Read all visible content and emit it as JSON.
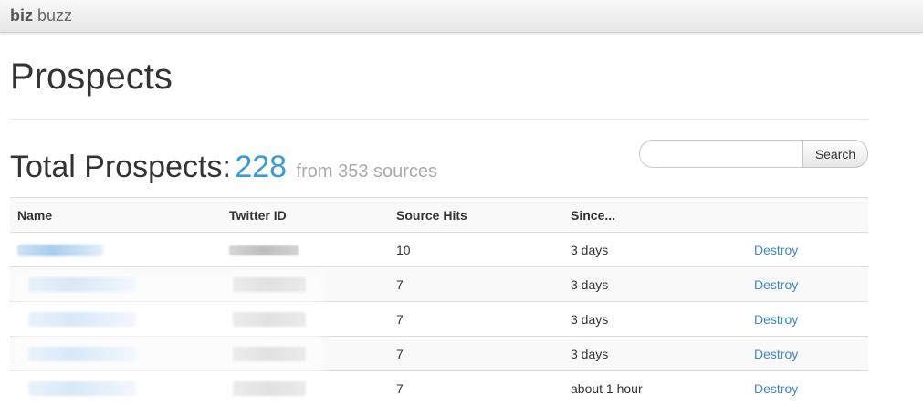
{
  "navbar": {
    "brand_bold": "biz",
    "brand_light": "buzz"
  },
  "page": {
    "title": "Prospects"
  },
  "summary": {
    "label": "Total Prospects:",
    "count": "228",
    "sources_text": "from 353 sources"
  },
  "search": {
    "value": "",
    "placeholder": "",
    "button_label": "Search"
  },
  "table": {
    "headers": {
      "name": "Name",
      "twitter_id": "Twitter ID",
      "source_hits": "Source Hits",
      "since": "Since..."
    },
    "rows": [
      {
        "source_hits": "10",
        "since": "3 days",
        "action": "Destroy"
      },
      {
        "source_hits": "7",
        "since": "3 days",
        "action": "Destroy"
      },
      {
        "source_hits": "7",
        "since": "3 days",
        "action": "Destroy"
      },
      {
        "source_hits": "7",
        "since": "3 days",
        "action": "Destroy"
      },
      {
        "source_hits": "7",
        "since": "about 1 hour",
        "action": "Destroy"
      }
    ]
  },
  "colors": {
    "accent": "#3a9bd9",
    "link": "#3a88c9",
    "muted": "#aaaaaa"
  }
}
